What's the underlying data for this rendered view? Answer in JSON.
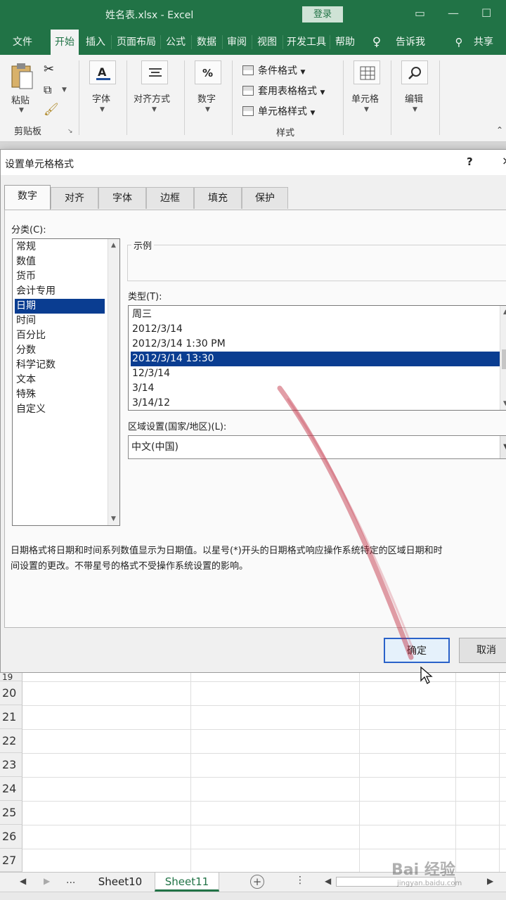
{
  "app": {
    "window_title": "姓名表.xlsx  -  Excel",
    "login_label": "登录"
  },
  "ribbon_tabs": [
    "文件",
    "开始",
    "插入",
    "页面布局",
    "公式",
    "数据",
    "审阅",
    "视图",
    "开发工具",
    "帮助"
  ],
  "tell_me_label": "告诉我",
  "share_label": "共享",
  "ribbon": {
    "paste_label": "粘贴",
    "clipboard_group": "剪贴板",
    "font_label": "字体",
    "alignment_label": "对齐方式",
    "number_label": "数字",
    "conditional_format": "条件格式",
    "table_format": "套用表格格式",
    "cell_styles": "单元格样式",
    "styles_group": "样式",
    "cells_label": "单元格",
    "editing_label": "编辑"
  },
  "dialog": {
    "title": "设置单元格格式",
    "help": "?",
    "close": "×",
    "tabs": [
      "数字",
      "对齐",
      "字体",
      "边框",
      "填充",
      "保护"
    ],
    "category_label": "分类(C):",
    "categories": [
      "常规",
      "数值",
      "货币",
      "会计专用",
      "日期",
      "时间",
      "百分比",
      "分数",
      "科学记数",
      "文本",
      "特殊",
      "自定义"
    ],
    "selected_category": "日期",
    "sample_label": "示例",
    "type_label": "类型(T):",
    "types": [
      "周三",
      "2012/3/14",
      "2012/3/14 1:30 PM",
      "2012/3/14 13:30",
      "12/3/14",
      "3/14",
      "3/14/12"
    ],
    "selected_type": "2012/3/14 13:30",
    "locale_label": "区域设置(国家/地区)(L):",
    "locale_value": "中文(中国)",
    "description_line1": "日期格式将日期和时间系列数值显示为日期值。以星号(*)开头的日期格式响应操作系统特定的区域日期和时",
    "description_line2": "间设置的更改。不带星号的格式不受操作系统设置的影响。",
    "ok_label": "确定",
    "cancel_label": "取消"
  },
  "sheet": {
    "row_numbers": [
      "19",
      "20",
      "21",
      "22",
      "23",
      "24",
      "25",
      "26",
      "27"
    ]
  },
  "sheet_tabs": {
    "ellipsis": "...",
    "tabs": [
      "Sheet10",
      "Sheet11"
    ],
    "active": "Sheet11",
    "add": "+"
  },
  "watermark": {
    "text": "Bai 经验",
    "url": "jingyan.baidu.com"
  },
  "colors": {
    "excel_green": "#217346",
    "selection_blue": "#0a3d91",
    "default_button_border": "#2a62c9"
  }
}
